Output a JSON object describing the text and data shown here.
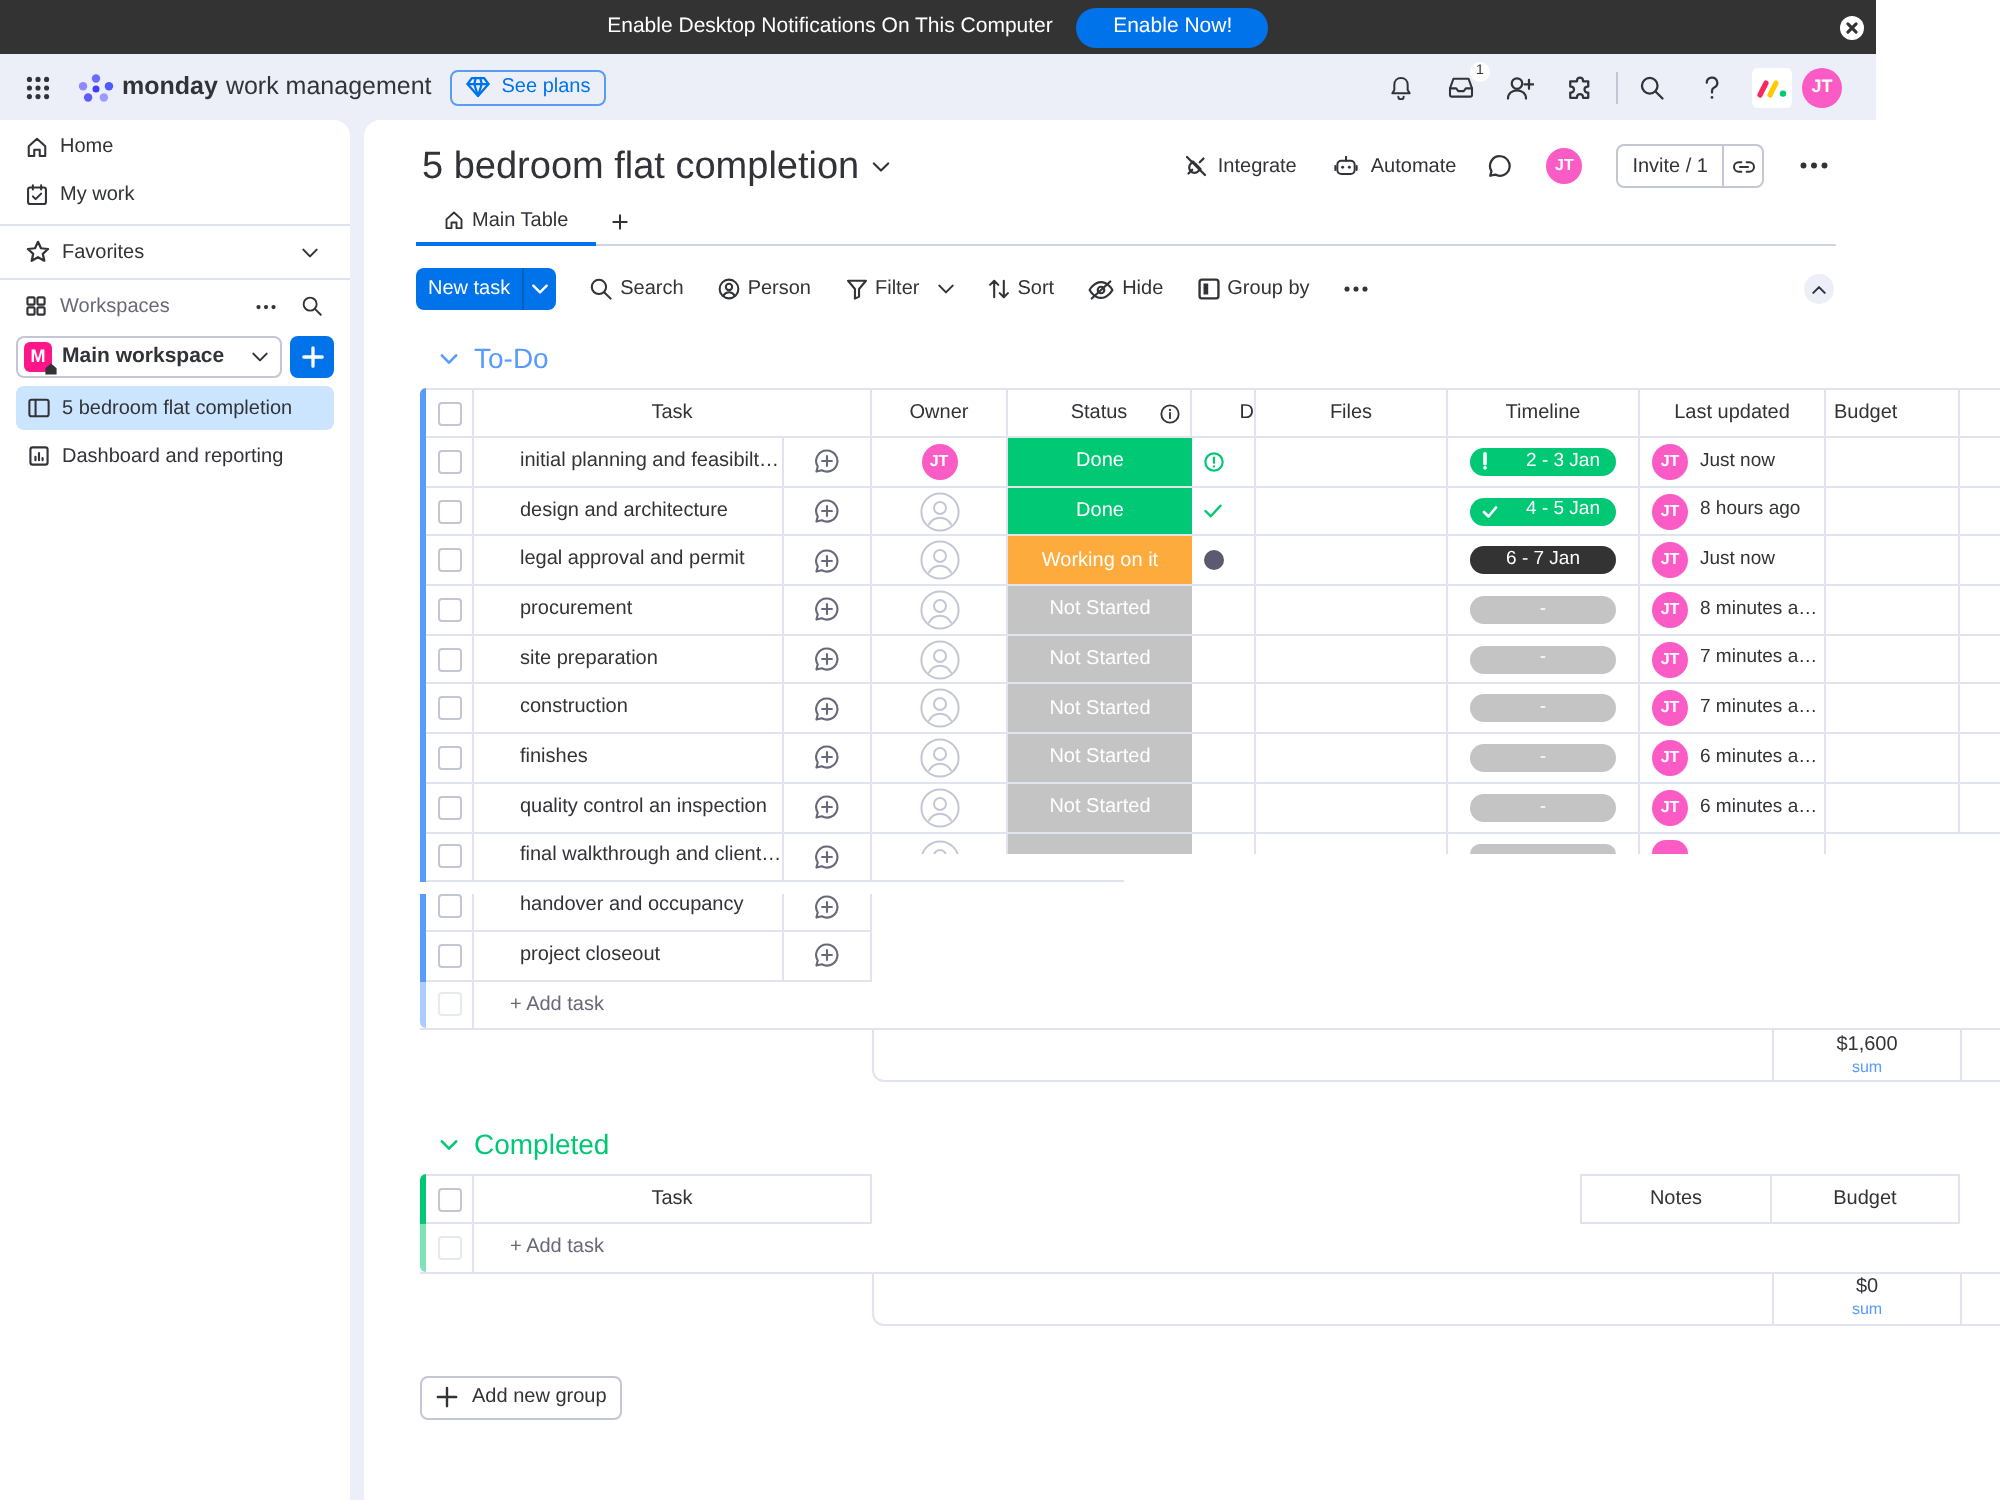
{
  "notification_bar": {
    "message": "Enable Desktop Notifications On This Computer",
    "button": "Enable Now!"
  },
  "top_bar": {
    "brand": "monday",
    "product": "work management",
    "plans_button": "See plans",
    "inbox_count": "1",
    "avatar": "JT"
  },
  "sidebar": {
    "nav": [
      {
        "label": "Home"
      },
      {
        "label": "My work"
      }
    ],
    "favorites": "Favorites",
    "workspaces": {
      "label": "Workspaces",
      "current": {
        "initial": "M",
        "name": "Main workspace"
      },
      "items": [
        {
          "label": "5 bedroom flat completion",
          "selected": true
        },
        {
          "label": "Dashboard and reporting",
          "selected": false
        }
      ]
    }
  },
  "board": {
    "title": "5 bedroom flat completion",
    "actions": [
      "Integrate",
      "Automate"
    ],
    "avatar": "JT",
    "invite": "Invite / 1",
    "views": [
      {
        "label": "Main Table",
        "selected": true
      }
    ],
    "toolbar": {
      "new_task": "New task",
      "items": [
        {
          "label": "Search",
          "menu": false
        },
        {
          "label": "Person",
          "menu": false
        },
        {
          "label": "Filter",
          "menu": true
        },
        {
          "label": "Sort",
          "menu": false
        },
        {
          "label": "Hide",
          "menu": false
        },
        {
          "label": "Group by",
          "menu": false
        }
      ]
    }
  },
  "groups": [
    {
      "kind": "table",
      "title": "To-Do",
      "color": "#579bfc",
      "select_all": {
        "checked": false
      },
      "columns": [
        "Task",
        "Owner",
        "Status",
        "D",
        "Files",
        "Timeline",
        "Last updated",
        "Budget"
      ],
      "rows": [
        {
          "kind": "full",
          "selected": false,
          "task": "initial planning and feasibilt…",
          "owner": "JT",
          "status": {
            "label": "Done",
            "color": "#00c875"
          },
          "indicator": {
            "kind": "alert"
          },
          "timeline": {
            "kind": "alert",
            "label": "2 - 3 Jan",
            "color": "#00c875"
          },
          "updated_by": "JT",
          "updated": "Just now"
        },
        {
          "kind": "full",
          "selected": false,
          "task": "design and architecture",
          "status": {
            "label": "Done",
            "color": "#00c875"
          },
          "indicator": {
            "kind": "check"
          },
          "timeline": {
            "kind": "check",
            "label": "4 - 5 Jan",
            "color": "#00c875"
          },
          "updated_by": "JT",
          "updated": "8 hours ago"
        },
        {
          "kind": "full",
          "selected": false,
          "task": "legal approval and permit",
          "status": {
            "label": "Working on it",
            "color": "#fdab3d"
          },
          "indicator": {
            "kind": "dot"
          },
          "timeline": {
            "kind": "plain",
            "label": "6 - 7 Jan",
            "color": "#333333"
          },
          "updated_by": "JT",
          "updated": "Just now"
        },
        {
          "kind": "full",
          "selected": false,
          "task": "procurement",
          "status": {
            "label": "Not Started",
            "color": "#c4c4c4"
          },
          "timeline": {
            "kind": "plain",
            "label": "-",
            "color": "#c4c4c4"
          },
          "updated_by": "JT",
          "updated": "8 minutes a…"
        },
        {
          "kind": "full",
          "selected": false,
          "task": "site preparation",
          "status": {
            "label": "Not Started",
            "color": "#c4c4c4"
          },
          "timeline": {
            "kind": "plain",
            "label": "-",
            "color": "#c4c4c4"
          },
          "updated_by": "JT",
          "updated": "7 minutes a…"
        },
        {
          "kind": "full",
          "selected": false,
          "task": "construction",
          "status": {
            "label": "Not Started",
            "color": "#c4c4c4"
          },
          "timeline": {
            "kind": "plain",
            "label": "-",
            "color": "#c4c4c4"
          },
          "updated_by": "JT",
          "updated": "7 minutes a…"
        },
        {
          "kind": "full",
          "selected": false,
          "task": "finishes",
          "status": {
            "label": "Not Started",
            "color": "#c4c4c4"
          },
          "timeline": {
            "kind": "plain",
            "label": "-",
            "color": "#c4c4c4"
          },
          "updated_by": "JT",
          "updated": "6 minutes a…"
        },
        {
          "kind": "full",
          "selected": false,
          "task": "quality control an inspection",
          "status": {
            "label": "Not Started",
            "color": "#c4c4c4"
          },
          "timeline": {
            "kind": "plain",
            "label": "-",
            "color": "#c4c4c4"
          },
          "updated_by": "JT",
          "updated": "6 minutes a…"
        },
        {
          "kind": "partial",
          "selected": false,
          "task": "final walkthrough and client…",
          "status": {
            "color": "#c4c4c4"
          },
          "timeline": {
            "color": "#c4c4c4"
          }
        },
        {
          "kind": "task_only",
          "selected": false,
          "task": "handover and occupancy"
        },
        {
          "kind": "task_only",
          "selected": false,
          "task": "project closeout"
        }
      ],
      "add_task": {
        "label": "+ Add task",
        "checkbox_disabled": true
      },
      "summary": {
        "value": "$1,600",
        "label": "sum"
      }
    },
    {
      "kind": "clipped",
      "title": "Completed",
      "color": "#00c875",
      "select_all": {
        "checked": false
      },
      "columns": [
        "Task",
        "Notes",
        "Budget"
      ],
      "add_task": {
        "label": "+ Add task",
        "checkbox_disabled": true
      },
      "summary": {
        "value": "$0",
        "label": "sum"
      }
    }
  ],
  "add_group": "Add new group"
}
